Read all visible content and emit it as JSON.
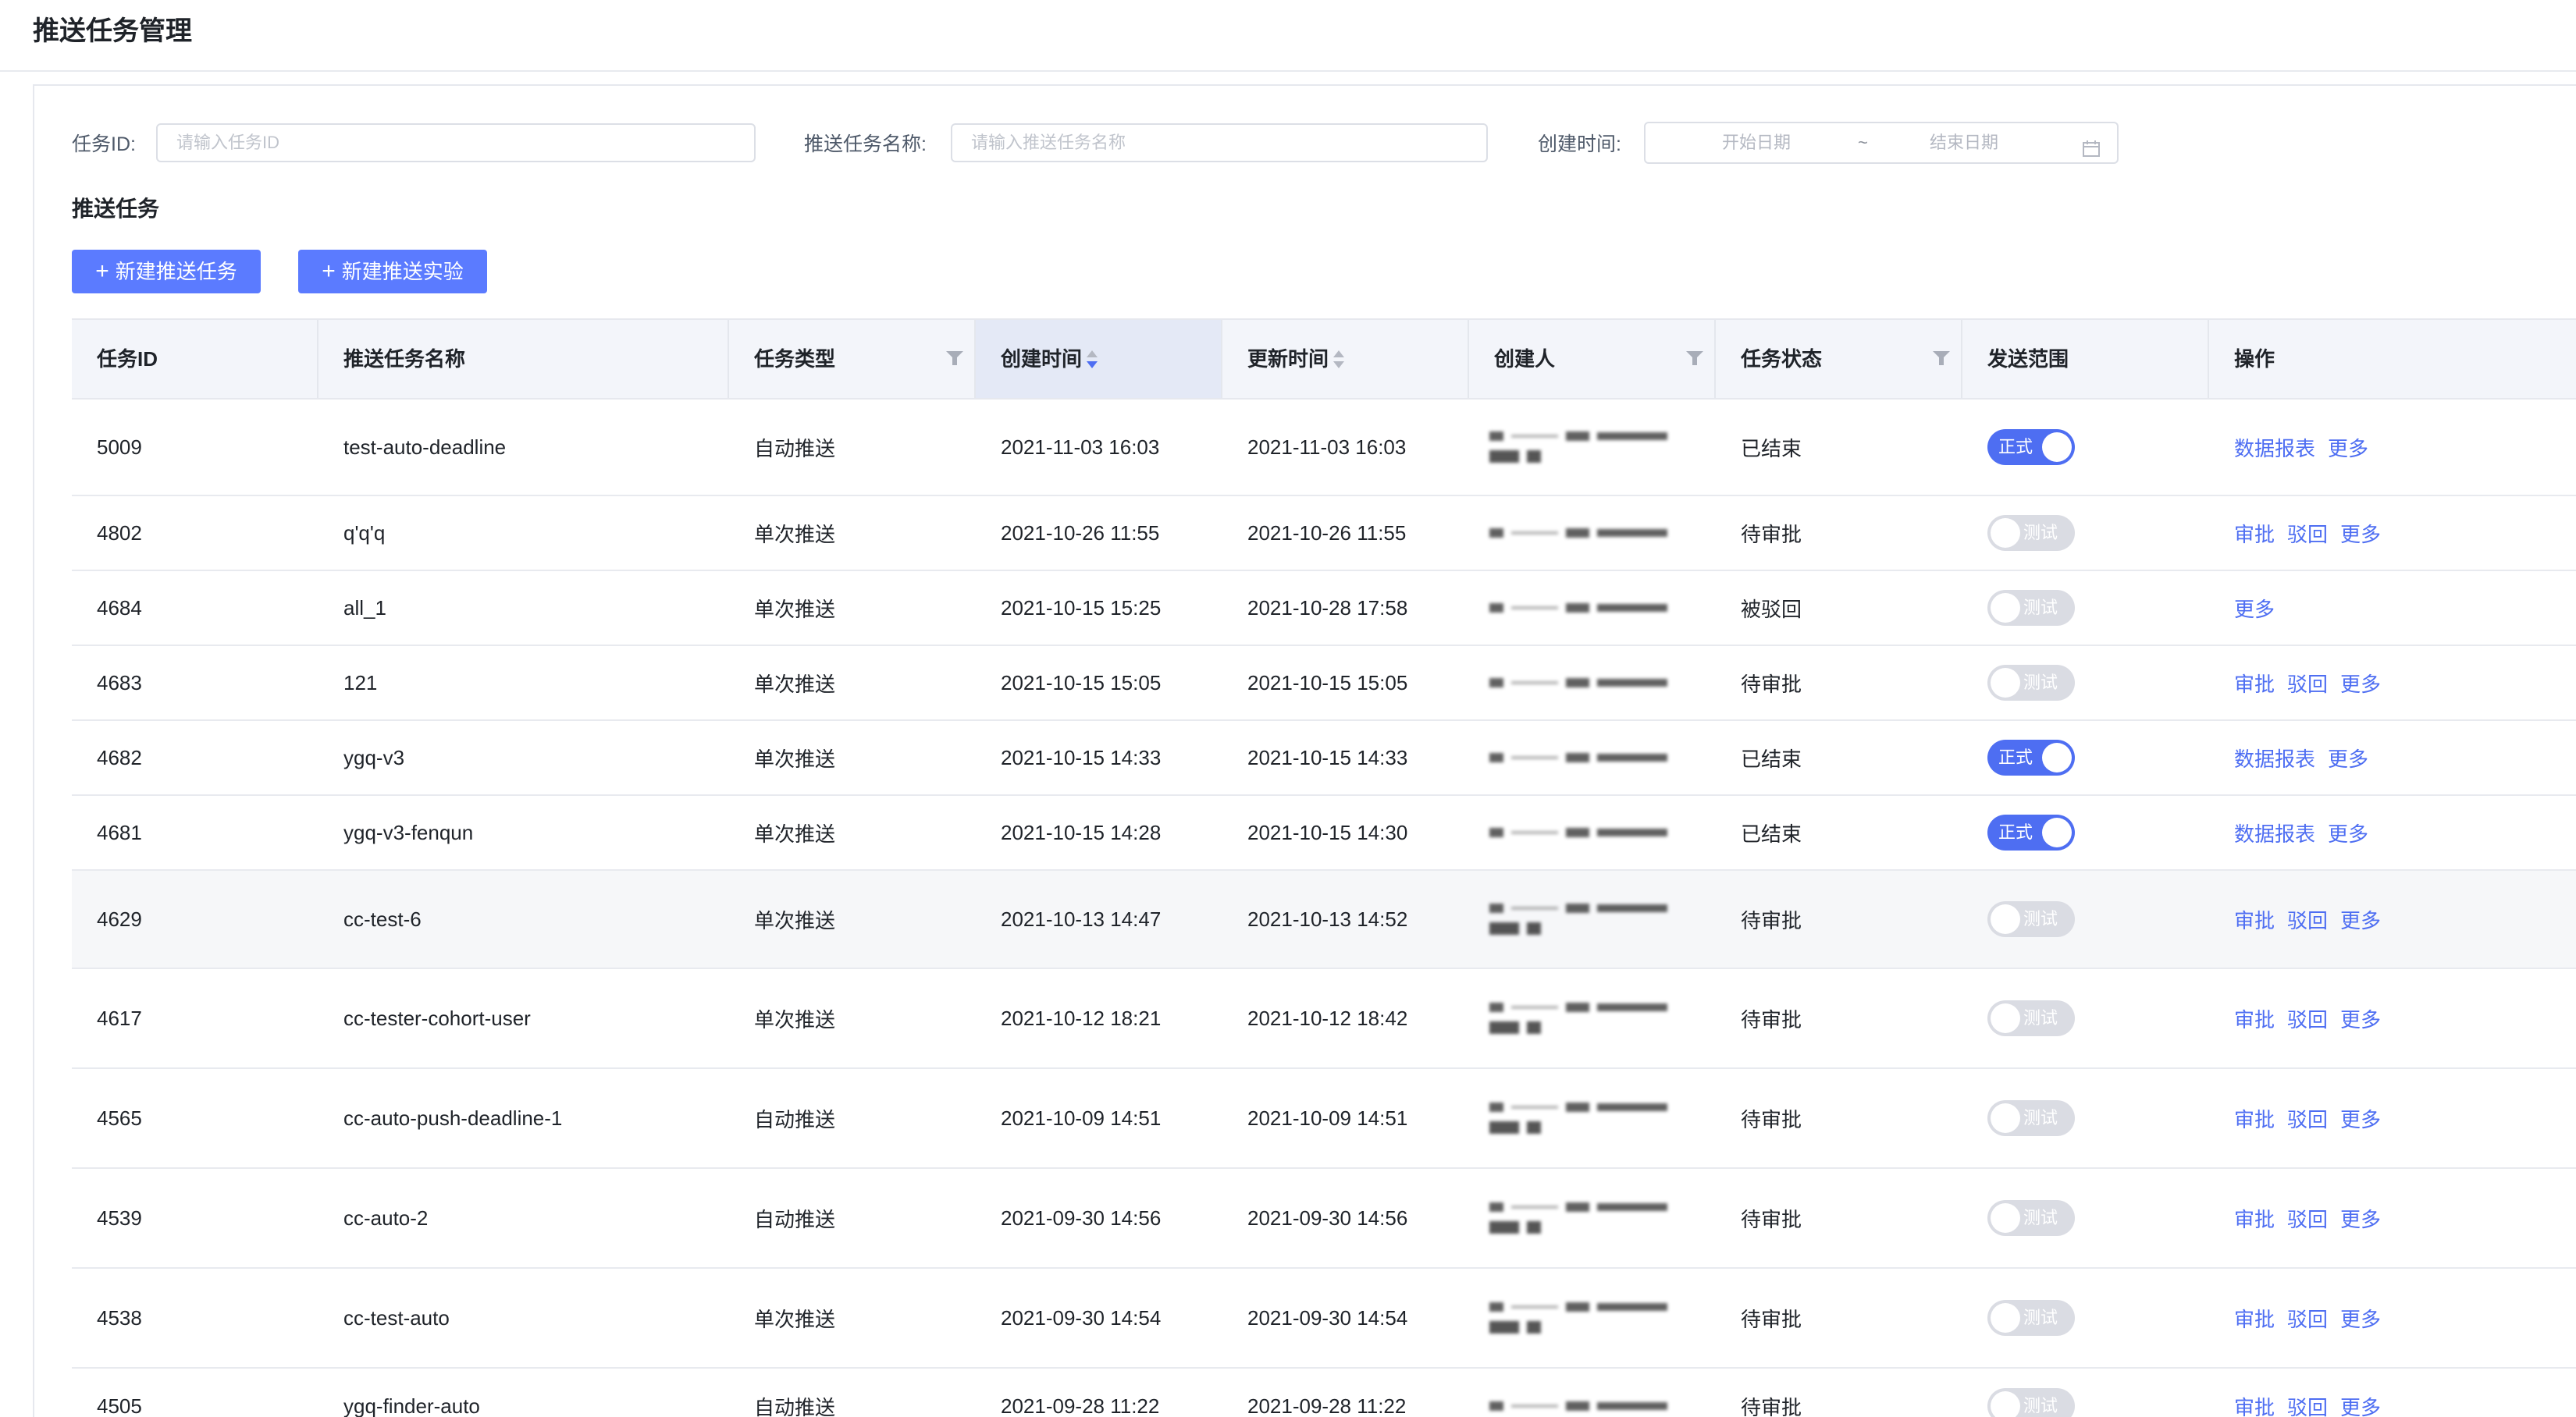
{
  "page": {
    "title": "推送任务管理"
  },
  "filters": {
    "task_id_label": "任务ID:",
    "task_id_placeholder": "请输入任务ID",
    "task_name_label": "推送任务名称:",
    "task_name_placeholder": "请输入推送任务名称",
    "created_label": "创建时间:",
    "start_date_placeholder": "开始日期",
    "date_separator": "~",
    "end_date_placeholder": "结束日期",
    "calendar_icon": "calendar-icon"
  },
  "section": {
    "title": "推送任务",
    "new_task_button": "新建推送任务",
    "new_experiment_button": "新建推送实验",
    "plus_icon": "plus-icon"
  },
  "colors": {
    "primary": "#5b7bff",
    "link": "#4e6ef2",
    "switch_off": "#dadce3"
  },
  "table": {
    "headers": {
      "id": "任务ID",
      "name": "推送任务名称",
      "type": "任务类型",
      "created": "创建时间",
      "updated": "更新时间",
      "creator": "创建人",
      "status": "任务状态",
      "scope": "发送范围",
      "ops": "操作"
    },
    "sorted_column": "创建时间",
    "sort_order": "descending",
    "rows": [
      {
        "id": "5009",
        "name": "test-auto-deadline",
        "type": "自动推送",
        "created": "2021-11-03 16:03",
        "updated": "2021-11-03 16:03",
        "status": "已结束",
        "scope": "正式",
        "scope_on": true,
        "ops": [
          "数据报表",
          "更多"
        ]
      },
      {
        "id": "4802",
        "name": "q'q'q",
        "type": "单次推送",
        "created": "2021-10-26 11:55",
        "updated": "2021-10-26 11:55",
        "status": "待审批",
        "scope": "测试",
        "scope_on": false,
        "ops": [
          "审批",
          "驳回",
          "更多"
        ]
      },
      {
        "id": "4684",
        "name": "all_1",
        "type": "单次推送",
        "created": "2021-10-15 15:25",
        "updated": "2021-10-28 17:58",
        "status": "被驳回",
        "scope": "测试",
        "scope_on": false,
        "ops": [
          "更多"
        ]
      },
      {
        "id": "4683",
        "name": "121",
        "type": "单次推送",
        "created": "2021-10-15 15:05",
        "updated": "2021-10-15 15:05",
        "status": "待审批",
        "scope": "测试",
        "scope_on": false,
        "ops": [
          "审批",
          "驳回",
          "更多"
        ]
      },
      {
        "id": "4682",
        "name": "ygq-v3",
        "type": "单次推送",
        "created": "2021-10-15 14:33",
        "updated": "2021-10-15 14:33",
        "status": "已结束",
        "scope": "正式",
        "scope_on": true,
        "ops": [
          "数据报表",
          "更多"
        ]
      },
      {
        "id": "4681",
        "name": "ygq-v3-fenqun",
        "type": "单次推送",
        "created": "2021-10-15 14:28",
        "updated": "2021-10-15 14:30",
        "status": "已结束",
        "scope": "正式",
        "scope_on": true,
        "ops": [
          "数据报表",
          "更多"
        ]
      },
      {
        "id": "4629",
        "name": "cc-test-6",
        "type": "单次推送",
        "created": "2021-10-13 14:47",
        "updated": "2021-10-13 14:52",
        "status": "待审批",
        "scope": "测试",
        "scope_on": false,
        "ops": [
          "审批",
          "驳回",
          "更多"
        ]
      },
      {
        "id": "4617",
        "name": "cc-tester-cohort-user",
        "type": "单次推送",
        "created": "2021-10-12 18:21",
        "updated": "2021-10-12 18:42",
        "status": "待审批",
        "scope": "测试",
        "scope_on": false,
        "ops": [
          "审批",
          "驳回",
          "更多"
        ]
      },
      {
        "id": "4565",
        "name": "cc-auto-push-deadline-1",
        "type": "自动推送",
        "created": "2021-10-09 14:51",
        "updated": "2021-10-09 14:51",
        "status": "待审批",
        "scope": "测试",
        "scope_on": false,
        "ops": [
          "审批",
          "驳回",
          "更多"
        ]
      },
      {
        "id": "4539",
        "name": "cc-auto-2",
        "type": "自动推送",
        "created": "2021-09-30 14:56",
        "updated": "2021-09-30 14:56",
        "status": "待审批",
        "scope": "测试",
        "scope_on": false,
        "ops": [
          "审批",
          "驳回",
          "更多"
        ]
      },
      {
        "id": "4538",
        "name": "cc-test-auto",
        "type": "单次推送",
        "created": "2021-09-30 14:54",
        "updated": "2021-09-30 14:54",
        "status": "待审批",
        "scope": "测试",
        "scope_on": false,
        "ops": [
          "审批",
          "驳回",
          "更多"
        ]
      },
      {
        "id": "4505",
        "name": "ygq-finder-auto",
        "type": "自动推送",
        "created": "2021-09-28 11:22",
        "updated": "2021-09-28 11:22",
        "status": "待审批",
        "scope": "测试",
        "scope_on": false,
        "ops": [
          "审批",
          "驳回",
          "更多"
        ]
      }
    ]
  }
}
